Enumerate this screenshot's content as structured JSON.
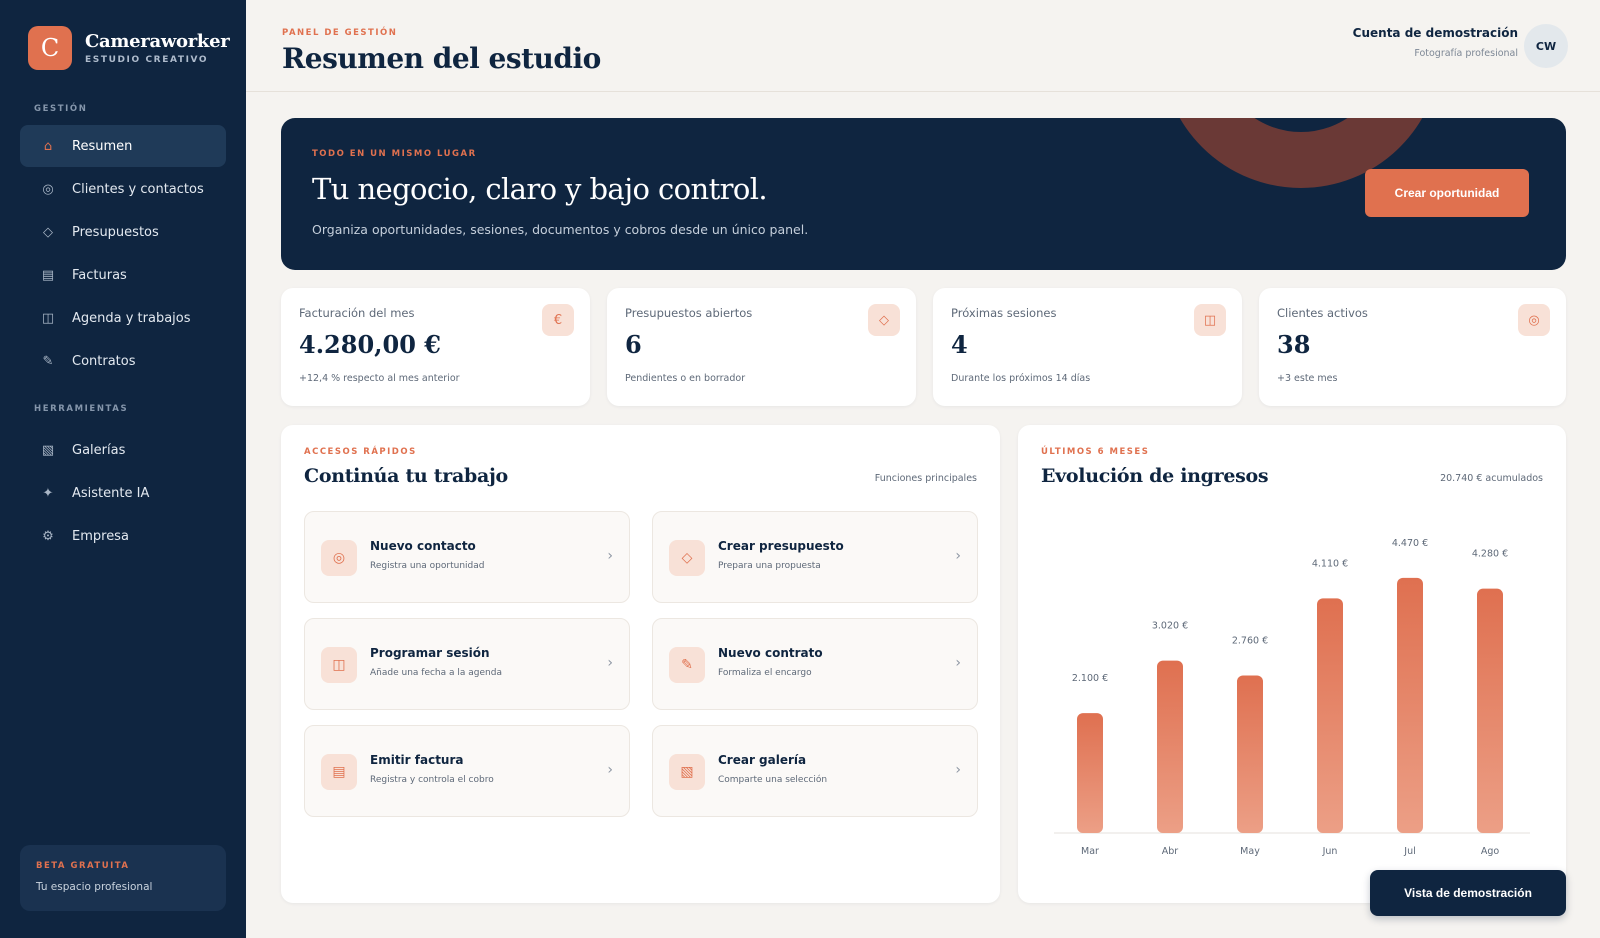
{
  "brand": {
    "logo_letter": "C",
    "name": "Cameraworker",
    "subtitle": "ESTUDIO CREATIVO"
  },
  "sidebar": {
    "section_gestion": "GESTIÓN",
    "section_herramientas": "HERRAMIENTAS",
    "items": [
      {
        "label": "Resumen",
        "icon": "home-icon",
        "glyph": "⌂"
      },
      {
        "label": "Clientes y contactos",
        "icon": "contacts-icon",
        "glyph": "◎"
      },
      {
        "label": "Presupuestos",
        "icon": "diamond-icon",
        "glyph": "◇"
      },
      {
        "label": "Facturas",
        "icon": "invoice-icon",
        "glyph": "▤"
      },
      {
        "label": "Agenda y trabajos",
        "icon": "calendar-icon",
        "glyph": "◫"
      },
      {
        "label": "Contratos",
        "icon": "pen-icon",
        "glyph": "✎"
      }
    ],
    "tools": [
      {
        "label": "Galerías",
        "icon": "gallery-icon",
        "glyph": "▧"
      },
      {
        "label": "Asistente IA",
        "icon": "sparkle-icon",
        "glyph": "✦"
      },
      {
        "label": "Empresa",
        "icon": "gear-icon",
        "glyph": "⚙"
      }
    ],
    "beta": {
      "title": "BETA GRATUITA",
      "subtitle": "Tu espacio profesional"
    }
  },
  "header": {
    "kicker": "PANEL DE GESTIÓN",
    "title": "Resumen del estudio",
    "account_name": "Cuenta de demostración",
    "account_role": "Fotografía profesional",
    "avatar_initials": "CW"
  },
  "hero": {
    "kicker": "TODO EN UN MISMO LUGAR",
    "title": "Tu negocio, claro y bajo control.",
    "subtitle": "Organiza oportunidades, sesiones, documentos y cobros desde un único panel.",
    "cta": "Crear oportunidad"
  },
  "stats": [
    {
      "label": "Facturación del mes",
      "value": "4.280,00 €",
      "note": "+12,4 % respecto al mes anterior",
      "icon": "euro-icon",
      "glyph": "€"
    },
    {
      "label": "Presupuestos abiertos",
      "value": "6",
      "note": "Pendientes o en borrador",
      "icon": "diamond-icon",
      "glyph": "◇"
    },
    {
      "label": "Próximas sesiones",
      "value": "4",
      "note": "Durante los próximos 14 días",
      "icon": "calendar-icon",
      "glyph": "◫"
    },
    {
      "label": "Clientes activos",
      "value": "38",
      "note": "+3 este mes",
      "icon": "contacts-icon",
      "glyph": "◎"
    }
  ],
  "quick": {
    "kicker": "ACCESOS RÁPIDOS",
    "title": "Continúa tu trabajo",
    "aside": "Funciones principales",
    "items": [
      {
        "title": "Nuevo contacto",
        "subtitle": "Registra una oportunidad",
        "icon": "contacts-icon",
        "glyph": "◎"
      },
      {
        "title": "Crear presupuesto",
        "subtitle": "Prepara una propuesta",
        "icon": "diamond-icon",
        "glyph": "◇"
      },
      {
        "title": "Programar sesión",
        "subtitle": "Añade una fecha a la agenda",
        "icon": "calendar-icon",
        "glyph": "◫"
      },
      {
        "title": "Nuevo contrato",
        "subtitle": "Formaliza el encargo",
        "icon": "pen-icon",
        "glyph": "✎"
      },
      {
        "title": "Emitir factura",
        "subtitle": "Registra y controla el cobro",
        "icon": "invoice-icon",
        "glyph": "▤"
      },
      {
        "title": "Crear galería",
        "subtitle": "Comparte una selección",
        "icon": "gallery-icon",
        "glyph": "▧"
      }
    ],
    "chevron": "›"
  },
  "revenue": {
    "kicker": "ÚLTIMOS 6 MESES",
    "title": "Evolución de ingresos",
    "aside": "20.740 € acumulados"
  },
  "chart_data": {
    "type": "bar",
    "categories": [
      "Mar",
      "Abr",
      "May",
      "Jun",
      "Jul",
      "Ago"
    ],
    "values": [
      2100,
      3020,
      2760,
      4110,
      4470,
      4280
    ],
    "data_labels": [
      "2.100 €",
      "3.020 €",
      "2.760 €",
      "4.110 €",
      "4.470 €",
      "4.280 €"
    ],
    "ylim": [
      0,
      4800
    ],
    "grid": false,
    "color_top": "#df7050",
    "color_bottom": "#ec9f86"
  },
  "demo_button": "Vista de demostración",
  "colors": {
    "navy": "#0f2540",
    "accent": "#e0714f",
    "background": "#f5f3f0"
  }
}
